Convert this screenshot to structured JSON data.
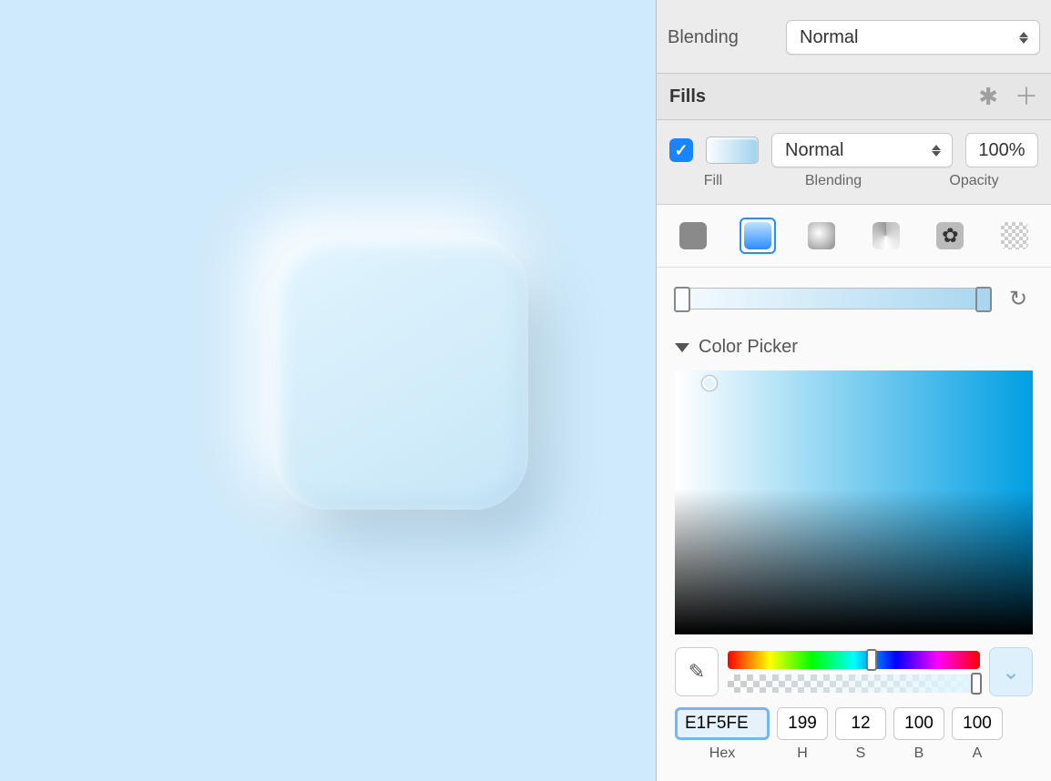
{
  "blending": {
    "label": "Blending",
    "mode": "Normal"
  },
  "fills": {
    "title": "Fills",
    "entry": {
      "blend_mode": "Normal",
      "opacity": "100%",
      "sub": {
        "fill": "Fill",
        "blending": "Blending",
        "opacity": "Opacity"
      }
    }
  },
  "picker": {
    "title": "Color Picker",
    "hex": "E1F5FE",
    "h": "199",
    "s": "12",
    "b": "100",
    "a": "100",
    "labels": {
      "hex": "Hex",
      "h": "H",
      "s": "S",
      "b": "B",
      "a": "A"
    }
  }
}
